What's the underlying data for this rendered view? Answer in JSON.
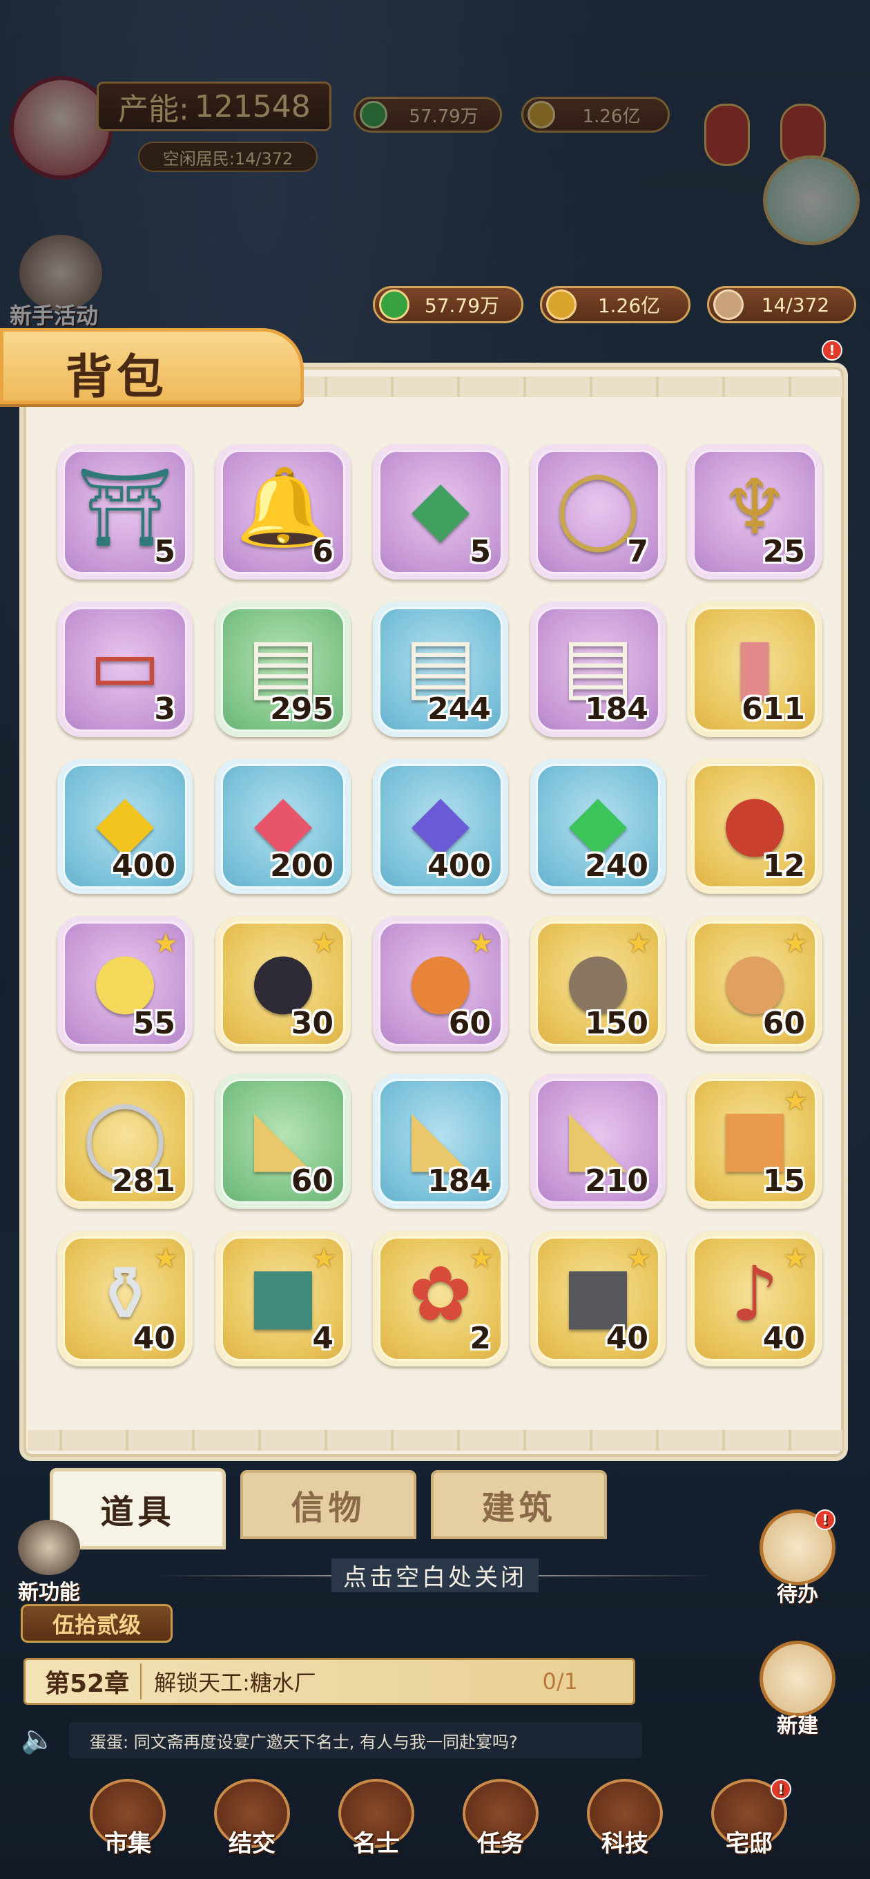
{
  "hud": {
    "production_label": "产能:",
    "production_value": "121548",
    "idle_residents": "空闲居民:14/372",
    "copper_top": "57.79万",
    "gold_top": "1.26亿",
    "newbie_event": "新手活动"
  },
  "resources": {
    "copper": "57.79万",
    "gold": "1.26亿",
    "residents": "14/372"
  },
  "panel": {
    "title": "背包",
    "items": [
      {
        "rarity": "purple",
        "icon": "incense-burner-icon",
        "count": "5",
        "star": false
      },
      {
        "rarity": "purple",
        "icon": "bell-icon",
        "count": "6",
        "star": false
      },
      {
        "rarity": "purple",
        "icon": "jade-pendant-icon",
        "count": "5",
        "star": false
      },
      {
        "rarity": "purple",
        "icon": "mirror-icon",
        "count": "7",
        "star": false
      },
      {
        "rarity": "purple",
        "icon": "oil-lamp-icon",
        "count": "25",
        "star": false
      },
      {
        "rarity": "purple",
        "icon": "talisman-card-icon",
        "count": "3",
        "star": false
      },
      {
        "rarity": "green",
        "icon": "scroll-green-icon",
        "count": "295",
        "star": false
      },
      {
        "rarity": "blue",
        "icon": "scroll-blue-icon",
        "count": "244",
        "star": false
      },
      {
        "rarity": "purple",
        "icon": "scroll-purple-icon",
        "count": "184",
        "star": false
      },
      {
        "rarity": "gold",
        "icon": "red-envelope-icon",
        "count": "611",
        "star": false
      },
      {
        "rarity": "blue",
        "icon": "yellow-gem-icon",
        "count": "400",
        "star": false
      },
      {
        "rarity": "blue",
        "icon": "red-gem-icon",
        "count": "200",
        "star": false
      },
      {
        "rarity": "blue",
        "icon": "purple-gem-icon",
        "count": "400",
        "star": false
      },
      {
        "rarity": "blue",
        "icon": "green-gem-icon",
        "count": "240",
        "star": false
      },
      {
        "rarity": "gold",
        "icon": "red-coin-icon",
        "count": "12",
        "star": false
      },
      {
        "rarity": "purple",
        "icon": "chick-pet-icon",
        "count": "55",
        "star": true
      },
      {
        "rarity": "gold",
        "icon": "crow-pet-icon",
        "count": "30",
        "star": true
      },
      {
        "rarity": "purple",
        "icon": "tiger-pet-icon",
        "count": "60",
        "star": true
      },
      {
        "rarity": "gold",
        "icon": "raccoon-pet-icon",
        "count": "150",
        "star": true
      },
      {
        "rarity": "gold",
        "icon": "cat-pet-icon",
        "count": "60",
        "star": true
      },
      {
        "rarity": "gold",
        "icon": "silver-bracelet-icon",
        "count": "281",
        "star": false
      },
      {
        "rarity": "green",
        "icon": "gold-shards-icon",
        "count": "60",
        "star": false
      },
      {
        "rarity": "blue",
        "icon": "gold-shards-icon",
        "count": "184",
        "star": false
      },
      {
        "rarity": "purple",
        "icon": "gold-shards-icon",
        "count": "210",
        "star": false
      },
      {
        "rarity": "gold",
        "icon": "treasure-chest-icon",
        "count": "15",
        "star": true
      },
      {
        "rarity": "gold",
        "icon": "porcelain-jar-icon",
        "count": "40",
        "star": true
      },
      {
        "rarity": "gold",
        "icon": "jade-box-icon",
        "count": "4",
        "star": true
      },
      {
        "rarity": "gold",
        "icon": "flower-vase-icon",
        "count": "2",
        "star": true
      },
      {
        "rarity": "gold",
        "icon": "ink-stone-icon",
        "count": "40",
        "star": true
      },
      {
        "rarity": "gold",
        "icon": "harp-icon",
        "count": "40",
        "star": true
      }
    ]
  },
  "tabs": [
    "道具",
    "信物",
    "建筑"
  ],
  "close_hint": "点击空白处关闭",
  "level_badge": "伍拾贰级",
  "chapter": {
    "label": "第52章",
    "task": "解锁天工:糖水厂",
    "progress": "0/1"
  },
  "broadcast": "蛋蛋: 同文斋再度设宴广邀天下名士, 有人与我一同赴宴吗?",
  "side_buttons": {
    "new_feature": "新功能",
    "todo": "待办",
    "build": "新建"
  },
  "bottom_nav": [
    "市集",
    "结交",
    "名士",
    "任务",
    "科技",
    "宅邸"
  ]
}
